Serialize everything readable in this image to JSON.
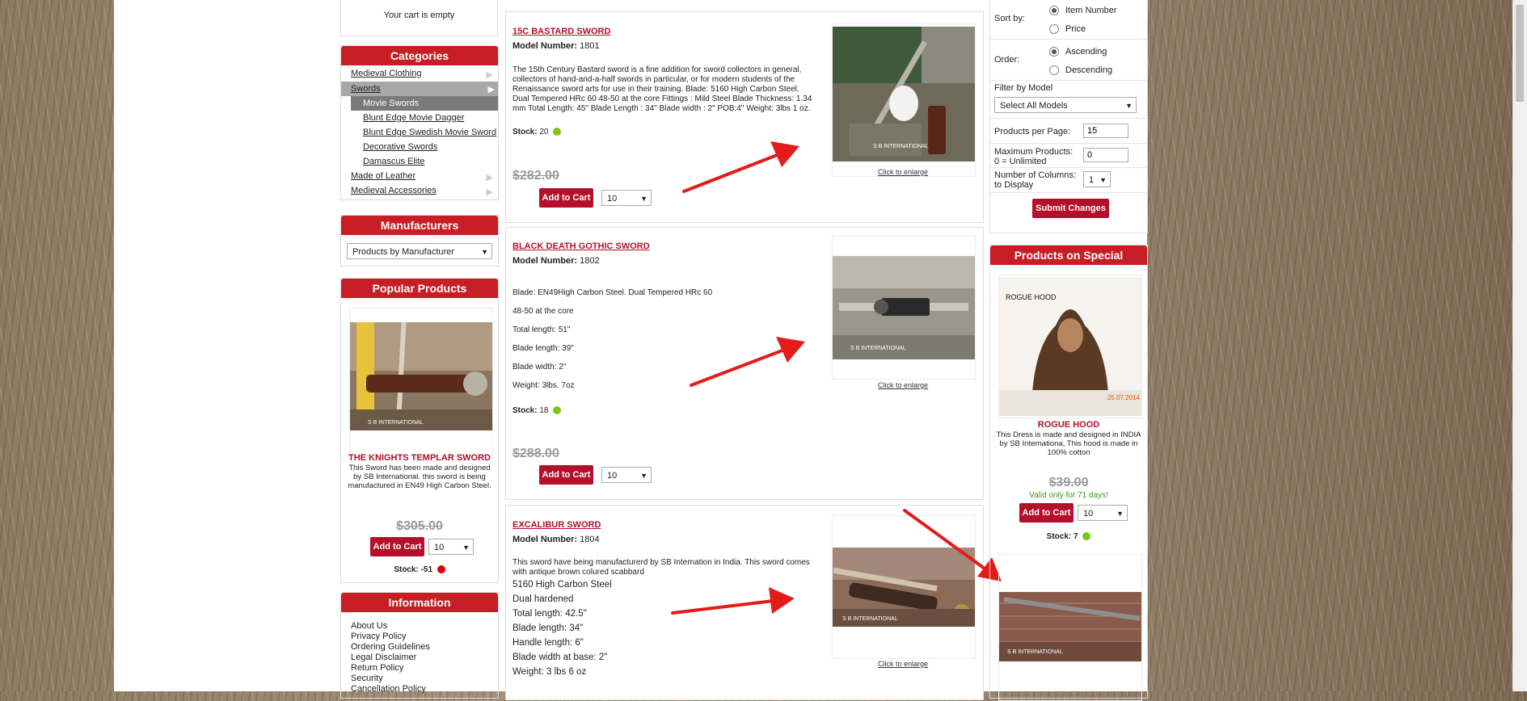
{
  "cart": {
    "empty_text": "Your cart is empty"
  },
  "categories": {
    "title": "Categories",
    "items": [
      {
        "label": "Medieval Clothing"
      },
      {
        "label": "Swords"
      },
      {
        "label": "Movie Swords"
      },
      {
        "label": "Blunt Edge Movie Dagger"
      },
      {
        "label": "Blunt Edge Swedish Movie Sword"
      },
      {
        "label": "Decorative Swords"
      },
      {
        "label": "Damascus Elite"
      },
      {
        "label": "Made of Leather"
      },
      {
        "label": "Medieval Accessories"
      }
    ]
  },
  "manufacturers": {
    "title": "Manufacturers",
    "selected": "Products by Manufacturer"
  },
  "popular": {
    "title": "Popular Products",
    "name": "THE KNIGHTS TEMPLAR SWORD",
    "desc": "This Sword has been made and designed by SB International. this sword is being manufactured in EN49 High Carbon Steel.",
    "price": "$305.00",
    "add_label": "Add to Cart",
    "qty": "10",
    "stock_label": "Stock:",
    "stock_value": "-51"
  },
  "information": {
    "title": "Information",
    "links": [
      "About Us",
      "Privacy Policy",
      "Ordering Guidelines",
      "Legal Disclaimer",
      "Return Policy",
      "Security",
      "Cancellation Policy"
    ]
  },
  "products": [
    {
      "title": "15C BASTARD SWORD",
      "model_label": "Model Number:",
      "model": "1801",
      "lines": [
        "The 15th Century Bastard sword is a fine addition for sword collectors in general, collectors of hand-and-a-half swords in particular, or for modern students of the Renaissance sword arts for use in their training. Blade: 5160 High Carbon Steel. Dual Tempered HRc 60 48-50 at the core Fittings : Mild Steel Blade Thickness: 1.34 mm Total Length: 45\" Blade Length : 34\" Blade width : 2\" POB:4\" Weight: 3lbs 1 oz."
      ],
      "stock_label": "Stock:",
      "stock": "20",
      "price": "$282.00",
      "add_label": "Add to Cart",
      "qty": "10",
      "enlarge": "Click to enlarge"
    },
    {
      "title": "BLACK DEATH GOTHIC SWORD",
      "model_label": "Model Number:",
      "model": "1802",
      "lines": [
        "Blade: EN49High Carbon Steel. Dual Tempered HRc 60",
        "48-50 at the core",
        "Total length: 51\"",
        "Blade length: 39\"",
        "Blade width: 2\"",
        "Weight: 3lbs. 7oz"
      ],
      "stock_label": "Stock:",
      "stock": "18",
      "price": "$288.00",
      "add_label": "Add to Cart",
      "qty": "10",
      "enlarge": "Click to enlarge"
    },
    {
      "title": "EXCALIBUR SWORD",
      "model_label": "Model Number:",
      "model": "1804",
      "intro": "This sword have being manufacturerd by SB Internation in India. This sword comes with antique brown colured scabbard",
      "lines": [
        "5160 High Carbon Steel",
        "Dual hardened",
        "Total length: 42.5\"",
        "Blade length: 34\"",
        "Handle length: 6\"",
        "Blade width at base: 2\"",
        "Weight: 3 lbs 6 oz"
      ],
      "enlarge": "Click to enlarge"
    }
  ],
  "sort": {
    "label": "Sort by:",
    "options": [
      "Item Number",
      "Price"
    ],
    "order_label": "Order:",
    "order_options": [
      "Ascending",
      "Descending"
    ],
    "filter_label": "Filter by Model",
    "filter_selected": "Select All Models",
    "ppp_label": "Products per Page:",
    "ppp_value": "15",
    "max_label_1": "Maximum Products:",
    "max_label_2": "0 = Unlimited",
    "max_value": "0",
    "cols_label_1": "Number of Columns:",
    "cols_label_2": "to Display",
    "cols_value": "1",
    "submit": "Submit Changes"
  },
  "special": {
    "title": "Products on Special",
    "image_caption": "ROGUE HOOD",
    "image_date": "25.07.2014",
    "name": "ROGUE HOOD",
    "desc": "This Dress is made and designed in INDIA by SB Internationa, This hood is made in 100% cotton",
    "price": "$39.00",
    "valid": "Valid only for 71 days!",
    "add_label": "Add to Cart",
    "qty": "10",
    "stock_label": "Stock:",
    "stock": "7"
  },
  "colors": {
    "brand_red": "#c81d24",
    "button_red": "#b5102a",
    "stock_green": "#7cc41f",
    "stock_red": "#e00000",
    "valid_green": "#3a9a1a"
  }
}
